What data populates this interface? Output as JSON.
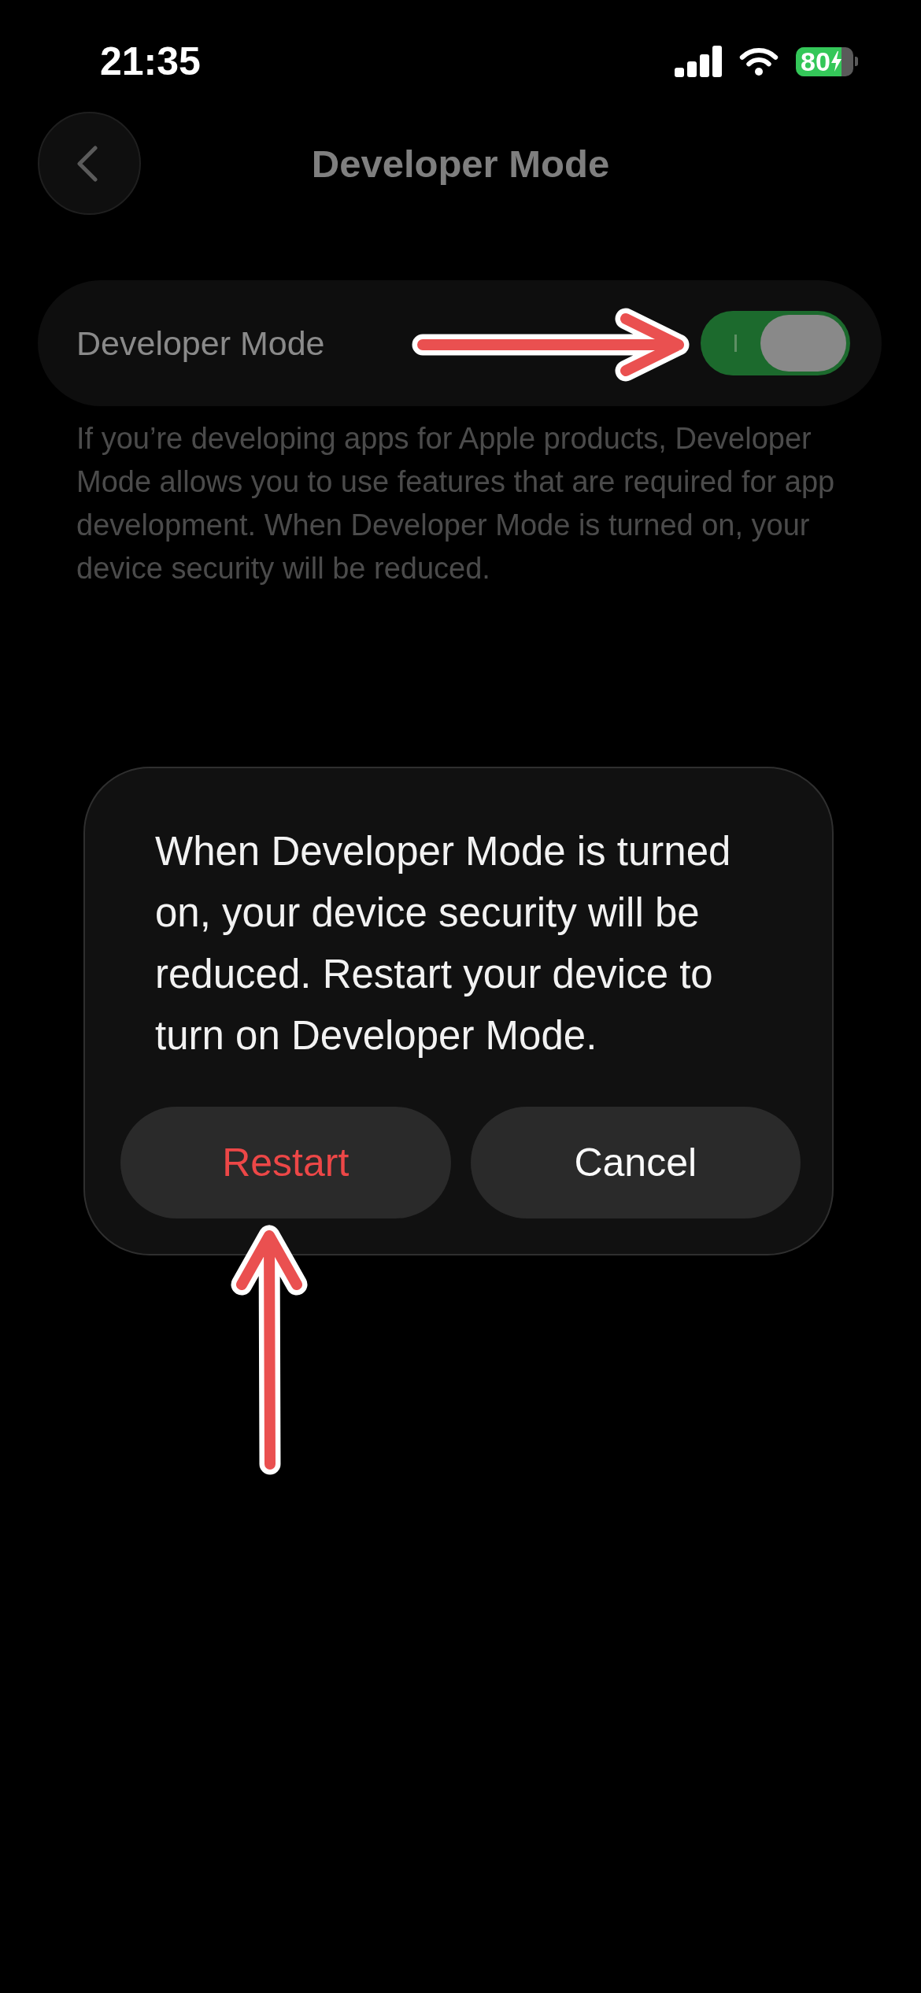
{
  "status_bar": {
    "time": "21:35",
    "battery": "80"
  },
  "nav": {
    "title": "Developer Mode"
  },
  "settings": [
    {
      "label": "Developer Mode",
      "on": true
    }
  ],
  "footer": "If you’re developing apps for Apple products, Developer Mode allows you to use features that are required for app development. When Developer Mode is turned on, your device security will be reduced.",
  "alert": {
    "message": "When Developer Mode is turned on, your device security will be reduced. Restart your device to turn on Developer Mode.",
    "buttons": [
      {
        "label": "Restart",
        "kind": "destructive"
      },
      {
        "label": "Cancel",
        "kind": "default"
      }
    ]
  }
}
